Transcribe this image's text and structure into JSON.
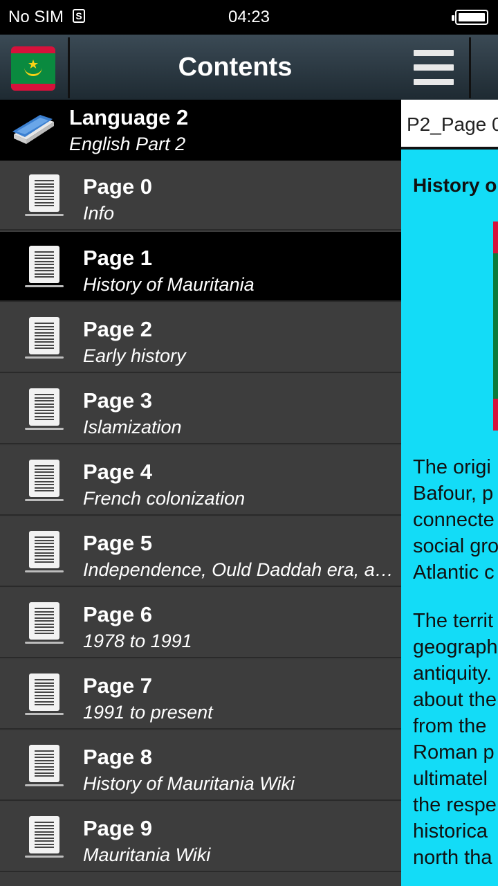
{
  "status_bar": {
    "carrier": "No SIM",
    "time": "04:23"
  },
  "drawer": {
    "title": "Contents",
    "section": {
      "title": "Language 2",
      "subtitle": "English Part 2"
    },
    "items": [
      {
        "title": "Page 0",
        "subtitle": "Info",
        "active": false
      },
      {
        "title": "Page 1",
        "subtitle": "History of Mauritania",
        "active": true
      },
      {
        "title": "Page 2",
        "subtitle": "Early history",
        "active": false
      },
      {
        "title": "Page 3",
        "subtitle": "Islamization",
        "active": false
      },
      {
        "title": "Page 4",
        "subtitle": "French colonization",
        "active": false
      },
      {
        "title": "Page 5",
        "subtitle": "Independence, Ould Daddah era, and…",
        "active": false
      },
      {
        "title": "Page 6",
        "subtitle": "1978 to 1991",
        "active": false
      },
      {
        "title": "Page 7",
        "subtitle": "1991 to present",
        "active": false
      },
      {
        "title": "Page 8",
        "subtitle": "History of Mauritania Wiki",
        "active": false
      },
      {
        "title": "Page 9",
        "subtitle": "Mauritania Wiki",
        "active": false
      }
    ]
  },
  "content": {
    "page_label": "P2_Page 0",
    "heading": "History o",
    "paragraph1": [
      "The origi",
      "Bafour, p",
      "connecte",
      "social gro",
      "Atlantic c"
    ],
    "paragraph2": [
      "The territ",
      "geograph",
      "antiquity.",
      "about the",
      "from the",
      "Roman p",
      "ultimatel",
      "the respe",
      "historica",
      "north tha"
    ]
  },
  "colors": {
    "content_bg": "#13dcf7",
    "drawer_bg": "#3c3c3c",
    "active_item_bg": "#000000"
  }
}
